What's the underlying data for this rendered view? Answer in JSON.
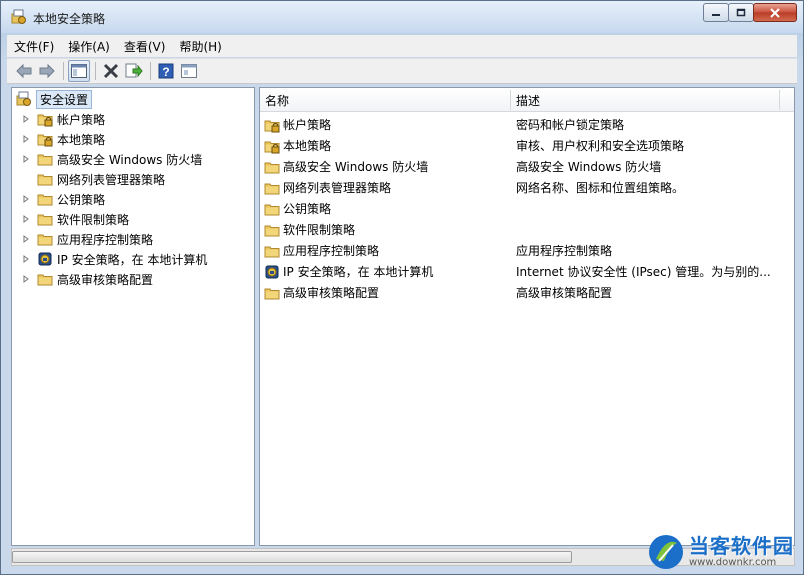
{
  "window": {
    "title": "本地安全策略"
  },
  "menu": [
    {
      "label": "文件(F)"
    },
    {
      "label": "操作(A)"
    },
    {
      "label": "查看(V)"
    },
    {
      "label": "帮助(H)"
    }
  ],
  "toolbar": {
    "buttons": [
      "back-icon",
      "forward-icon",
      "show-hide-tree-icon",
      "delete-icon",
      "export-list-icon",
      "help-icon",
      "properties-icon"
    ]
  },
  "tree": {
    "root": {
      "label": "安全设置"
    },
    "items": [
      {
        "label": "帐户策略",
        "icon": "folder-lock-icon",
        "expandable": true
      },
      {
        "label": "本地策略",
        "icon": "folder-lock-icon",
        "expandable": true
      },
      {
        "label": "高级安全 Windows 防火墙",
        "icon": "folder-icon",
        "expandable": true
      },
      {
        "label": "网络列表管理器策略",
        "icon": "folder-icon",
        "expandable": false
      },
      {
        "label": "公钥策略",
        "icon": "folder-icon",
        "expandable": true
      },
      {
        "label": "软件限制策略",
        "icon": "folder-icon",
        "expandable": true
      },
      {
        "label": "应用程序控制策略",
        "icon": "folder-icon",
        "expandable": true
      },
      {
        "label": "IP 安全策略，在 本地计算机",
        "icon": "ipsec-icon",
        "expandable": true
      },
      {
        "label": "高级审核策略配置",
        "icon": "folder-icon",
        "expandable": true
      }
    ]
  },
  "list": {
    "columns": {
      "name": "名称",
      "description": "描述"
    },
    "rows": [
      {
        "name": "帐户策略",
        "desc": "密码和帐户锁定策略",
        "icon": "folder-lock-icon"
      },
      {
        "name": "本地策略",
        "desc": "审核、用户权利和安全选项策略",
        "icon": "folder-lock-icon"
      },
      {
        "name": "高级安全 Windows 防火墙",
        "desc": "高级安全 Windows 防火墙",
        "icon": "folder-icon"
      },
      {
        "name": "网络列表管理器策略",
        "desc": "网络名称、图标和位置组策略。",
        "icon": "folder-icon"
      },
      {
        "name": "公钥策略",
        "desc": "",
        "icon": "folder-icon"
      },
      {
        "name": "软件限制策略",
        "desc": "",
        "icon": "folder-icon"
      },
      {
        "name": "应用程序控制策略",
        "desc": "应用程序控制策略",
        "icon": "folder-icon"
      },
      {
        "name": "IP 安全策略，在 本地计算机",
        "desc": "Internet 协议安全性 (IPsec) 管理。为与别的...",
        "icon": "ipsec-icon"
      },
      {
        "name": "高级审核策略配置",
        "desc": "高级审核策略配置",
        "icon": "folder-icon"
      }
    ]
  },
  "watermark": {
    "name": "当客软件园",
    "url": "www.downkr.com"
  },
  "colors": {
    "folder": "#e8c45a",
    "accent": "#1b6fc8"
  }
}
